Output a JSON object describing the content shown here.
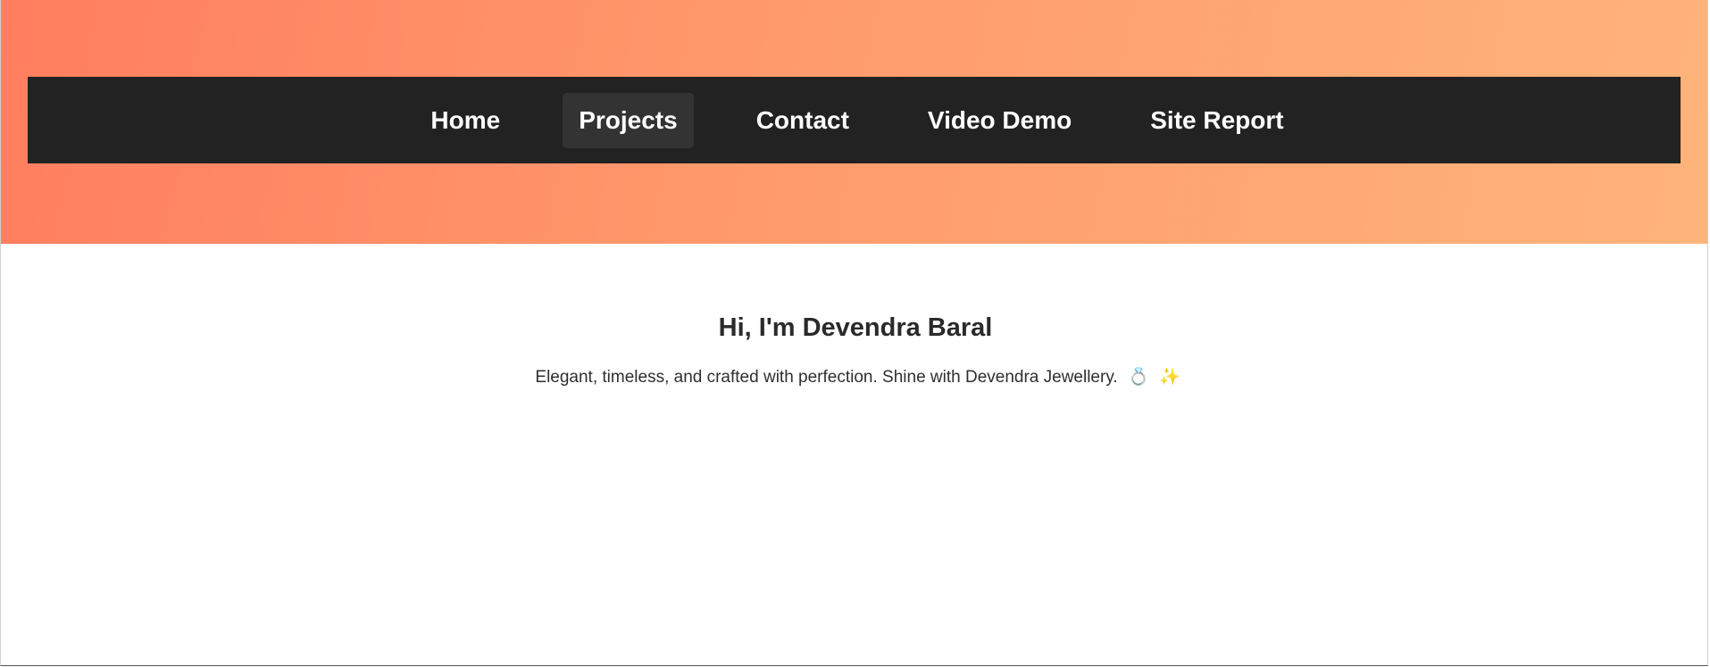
{
  "nav": {
    "items": [
      {
        "label": "Home",
        "active": false
      },
      {
        "label": "Projects",
        "active": true
      },
      {
        "label": "Contact",
        "active": false
      },
      {
        "label": "Video Demo",
        "active": false
      },
      {
        "label": "Site Report",
        "active": false
      }
    ]
  },
  "main": {
    "title": "Hi, I'm Devendra Baral",
    "tagline": "Elegant, timeless, and crafted with perfection. Shine with Devendra Jewellery.",
    "tagline_emojis": [
      "💍",
      "✨"
    ]
  },
  "colors": {
    "gradient_start": "#ff7e5f",
    "gradient_end": "#feb47b",
    "nav_background": "#222222",
    "nav_active_background": "#333333",
    "nav_text": "#ffffff",
    "heading_text": "#2a2a2a"
  },
  "icons": {
    "ring": "ring-icon",
    "sparkles": "sparkles-icon"
  }
}
